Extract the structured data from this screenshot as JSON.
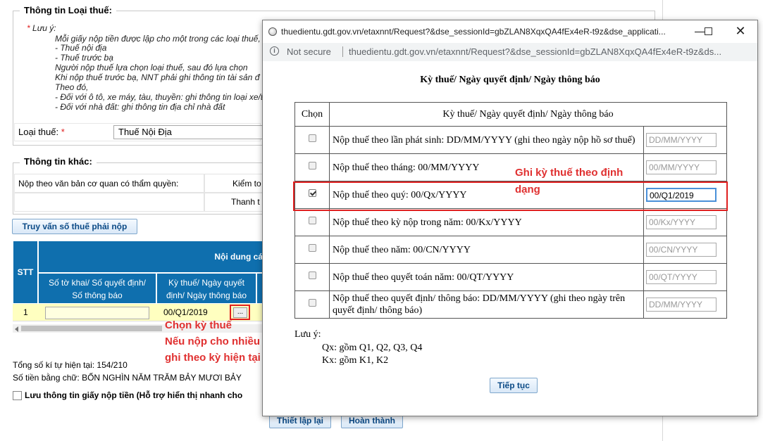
{
  "background": {
    "fieldset1_legend": "Thông tin Loại thuế:",
    "note_lines": [
      {
        "star": "* ",
        "text": "Lưu ý:"
      },
      {
        "star": "",
        "text": "Mỗi giấy nộp tiền được lập cho một trong các loại thuế,"
      },
      {
        "star": "",
        "text": "- Thuế nội địa"
      },
      {
        "star": "",
        "text": "- Thuế trước bạ"
      },
      {
        "star": "",
        "text": "Người nộp thuế lựa chọn loại thuế, sau đó lựa chọn"
      },
      {
        "star": "",
        "text": "Khi nộp thuế trước bạ, NNT phải ghi thông tin tài sản đ"
      },
      {
        "star": "",
        "text": "Theo đó,"
      },
      {
        "star": "",
        "text": "- Đối với ô tô, xe máy, tàu, thuyền: ghi thông tin loại xe/t"
      },
      {
        "star": "",
        "text": "- Đối với nhà đất: ghi thông tin địa chỉ nhà đất"
      }
    ],
    "tax_type_label": "Loại thuế:",
    "tax_type_required": "*",
    "tax_type_value": "Thuế Nội Địa",
    "fieldset2_legend": "Thông tin khác:",
    "authority_label": "Nộp theo văn bản cơ quan có thẩm quyền:",
    "col_kiemtoan": "Kiểm to",
    "col_thanhtra": "Thanh t",
    "query_button": "Truy vấn số thuế phải nộp",
    "table": {
      "stt_header": "STT",
      "group_header": "Nội dung cá",
      "col_doc_line1": "Số tờ khai/ Số quyết định/",
      "col_doc_line2": "Số thông báo",
      "col_period_line1": "Kỳ thuế/ Ngày quyết",
      "col_period_line2": "định/ Ngày thông báo",
      "row_stt": "1",
      "row_period": "00/Q1/2019",
      "picker_button": "..."
    },
    "char_count": "Tổng số kí tự hiện tại: 154/210",
    "amount_words": "Số tiền bằng chữ: BỐN NGHÌN NĂM TRĂM BẢY MƯƠI BẢY",
    "save_info_label": "Lưu thông tin giấy nộp tiền (Hỗ trợ hiển thị nhanh cho",
    "reset_button": "Thiết lập lại",
    "finish_button": "Hoàn thành"
  },
  "annotations": {
    "choose_period": "Chọn kỳ thuế",
    "multi_line1": "Nếu nộp cho nhiều kỳ thì",
    "multi_line2": "ghi theo kỳ hiện tại",
    "format_line1": "Ghi kỳ thuế theo định",
    "format_line2": "dạng",
    "color": "#e02020"
  },
  "popup": {
    "window_title": "thuedientu.gdt.gov.vn/etaxnnt/Request?&dse_sessionId=gbZLAN8XqxQA4fEx4eR-t9z&dse_applicati...",
    "not_secure": "Not secure",
    "url": "thuedientu.gdt.gov.vn/etaxnnt/Request?&dse_sessionId=gbZLAN8XqxQA4fEx4eR-t9z&ds...",
    "heading": "Kỳ thuế/ Ngày quyết định/ Ngày thông báo",
    "col_choose": "Chọn",
    "col_period": "Kỳ thuế/ Ngày quyết định/ Ngày thông báo",
    "rows": [
      {
        "label": "Nộp thuế theo lần phát sinh: DD/MM/YYYY (ghi theo ngày nộp hồ sơ thuế)",
        "placeholder": "DD/MM/YYYY",
        "value": "",
        "checked": false
      },
      {
        "label": "Nộp thuế theo tháng: 00/MM/YYYY",
        "placeholder": "00/MM/YYYY",
        "value": "",
        "checked": false
      },
      {
        "label": "Nộp thuế theo quý: 00/Qx/YYYY",
        "placeholder": "00/Qx/YYYY",
        "value": "00/Q1/2019",
        "checked": true
      },
      {
        "label": "Nộp thuế theo kỳ nộp trong năm: 00/Kx/YYYY",
        "placeholder": "00/Kx/YYYY",
        "value": "",
        "checked": false
      },
      {
        "label": "Nộp thuế theo năm: 00/CN/YYYY",
        "placeholder": "00/CN/YYYY",
        "value": "",
        "checked": false
      },
      {
        "label": "Nộp thuế theo quyết toán năm: 00/QT/YYYY",
        "placeholder": "00/QT/YYYY",
        "value": "",
        "checked": false
      },
      {
        "label": "Nộp thuế theo quyết định/ thông báo: DD/MM/YYYY (ghi theo ngày trên quyết định/ thông báo)",
        "placeholder": "DD/MM/YYYY",
        "value": "",
        "checked": false
      }
    ],
    "note_title": "Lưu ý:",
    "note_qx": "Qx: gồm Q1, Q2, Q3, Q4",
    "note_kx": "Kx: gồm K1, K2",
    "continue_button": "Tiếp tục"
  }
}
